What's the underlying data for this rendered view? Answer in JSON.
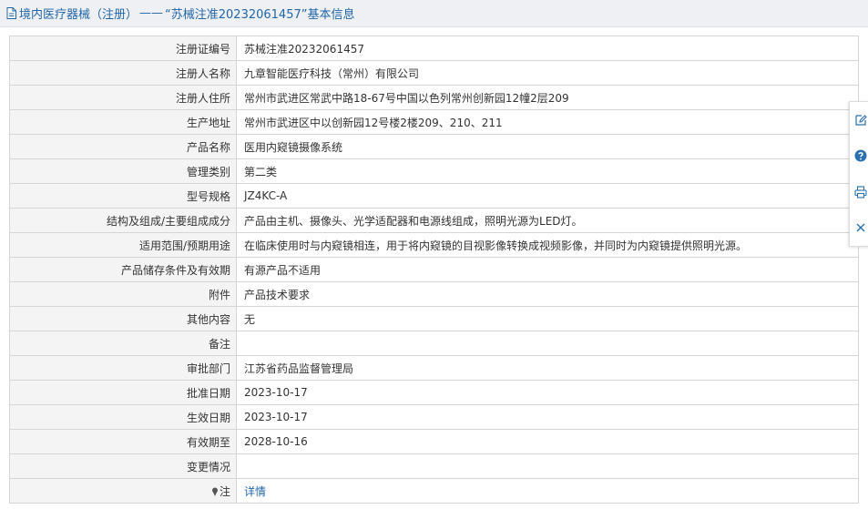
{
  "header": {
    "breadcrumb_category": "境内医疗器械（注册）",
    "separator": "——",
    "record_title": "“苏械注准20232061457”基本信息"
  },
  "rows": [
    {
      "label": "注册证编号",
      "value": "苏械注准20232061457"
    },
    {
      "label": "注册人名称",
      "value": "九章智能医疗科技（常州）有限公司"
    },
    {
      "label": "注册人住所",
      "value": "常州市武进区常武中路18-67号中国以色列常州创新园12幢2层209"
    },
    {
      "label": "生产地址",
      "value": "常州市武进区中以创新园12号楼2楼209、210、211"
    },
    {
      "label": "产品名称",
      "value": "医用内窥镜摄像系统"
    },
    {
      "label": "管理类别",
      "value": "第二类"
    },
    {
      "label": "型号规格",
      "value": "JZ4KC-A"
    },
    {
      "label": "结构及组成/主要组成成分",
      "value": "产品由主机、摄像头、光学适配器和电源线组成，照明光源为LED灯。"
    },
    {
      "label": "适用范围/预期用途",
      "value": "在临床使用时与内窥镜相连，用于将内窥镜的目视影像转换成视频影像，并同时为内窥镜提供照明光源。"
    },
    {
      "label": "产品储存条件及有效期",
      "value": "有源产品不适用"
    },
    {
      "label": "附件",
      "value": "产品技术要求"
    },
    {
      "label": "其他内容",
      "value": "无"
    },
    {
      "label": "备注",
      "value": ""
    },
    {
      "label": "审批部门",
      "value": "江苏省药品监督管理局"
    },
    {
      "label": "批准日期",
      "value": "2023-10-17"
    },
    {
      "label": "生效日期",
      "value": "2023-10-17"
    },
    {
      "label": "有效期至",
      "value": "2028-10-16"
    },
    {
      "label": "变更情况",
      "value": ""
    }
  ],
  "note_row": {
    "label": "注",
    "link": "详情"
  },
  "toolbar": {
    "icons": [
      "edit-icon",
      "help-icon",
      "print-icon",
      "close-icon"
    ]
  },
  "colors": {
    "link": "#2266aa",
    "label_bg": "#f4f4f4",
    "border": "#d5d5d5",
    "header_bg": "#eef0f3"
  }
}
